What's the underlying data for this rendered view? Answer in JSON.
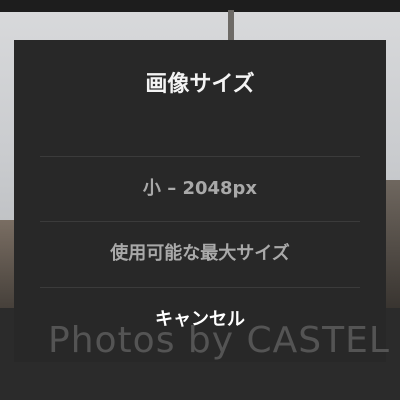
{
  "dialog": {
    "title": "画像サイズ",
    "options": [
      {
        "label": "小 – 2048px"
      },
      {
        "label": "使用可能な最大サイズ"
      }
    ],
    "cancel_label": "キャンセル"
  },
  "watermark": "Photos by CASTEL"
}
